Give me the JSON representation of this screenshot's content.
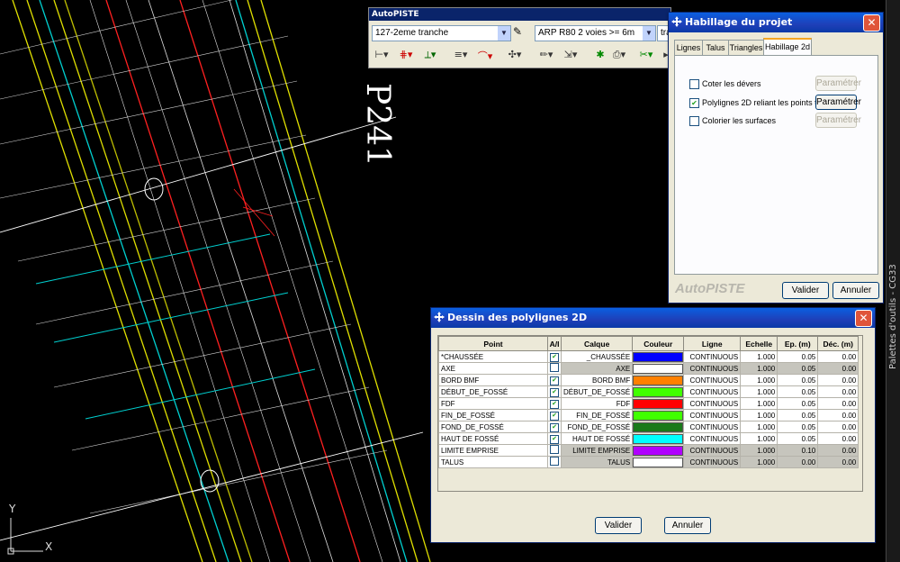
{
  "drawing": {
    "profile_label": "P241",
    "axis_y": "Y",
    "axis_x": "X"
  },
  "palette_side_label": "Palettes d'outils - CG33",
  "autopiste_toolbar": {
    "title": "AutoPISTE",
    "tranche_select": "127-2eme tranche",
    "profile_select": "ARP R80 2 voies >= 6m",
    "third_select": "tra",
    "tools": [
      "profile-tool-icon",
      "cross-section-tool-icon",
      "slope-tool-icon",
      "lines-tool-icon",
      "ditch-tool-icon",
      "axis-tool-icon",
      "draw-tool-icon",
      "export-tool-icon",
      "settings-tool-icon",
      "print-tool-icon",
      "layers-tool-icon",
      "help-tool-icon"
    ]
  },
  "habillage": {
    "title": "Habillage du projet",
    "tabs": [
      "Lignes",
      "Talus",
      "Triangles",
      "Habillage 2d"
    ],
    "active_tab": "Habillage 2d",
    "options": [
      {
        "label": "Coter les dévers",
        "checked": false,
        "button": "Paramétrer",
        "button_enabled": false
      },
      {
        "label": "Polylignes 2D reliant les points typés",
        "checked": true,
        "button": "Paramétrer",
        "button_enabled": true
      },
      {
        "label": "Colorier les surfaces",
        "checked": false,
        "button": "Paramétrer",
        "button_enabled": false
      }
    ],
    "brand": "AutoPISTE",
    "ok": "Valider",
    "cancel": "Annuler"
  },
  "dessin": {
    "title": "Dessin des polylignes 2D",
    "headers": [
      "Point",
      "A/I",
      "Calque",
      "Couleur",
      "Ligne",
      "Echelle",
      "Ep. (m)",
      "Déc. (m)"
    ],
    "rows": [
      {
        "point": "*CHAUSSÉE",
        "active": true,
        "calque": "_CHAUSSÉE",
        "color": "#0000ff",
        "ligne": "CONTINUOUS",
        "echelle": "1.000",
        "ep": "0.05",
        "dec": "0.00"
      },
      {
        "point": "AXE",
        "active": false,
        "calque": "AXE",
        "color": "#ffffff",
        "ligne": "CONTINUOUS",
        "echelle": "1.000",
        "ep": "0.05",
        "dec": "0.00"
      },
      {
        "point": "BORD BMF",
        "active": true,
        "calque": "BORD BMF",
        "color": "#ff8000",
        "ligne": "CONTINUOUS",
        "echelle": "1.000",
        "ep": "0.05",
        "dec": "0.00"
      },
      {
        "point": "DÉBUT_DE_FOSSÉ",
        "active": true,
        "calque": "DÉBUT_DE_FOSSÉ",
        "color": "#40ff00",
        "ligne": "CONTINUOUS",
        "echelle": "1.000",
        "ep": "0.05",
        "dec": "0.00"
      },
      {
        "point": "FDF",
        "active": true,
        "calque": "FDF",
        "color": "#ff0000",
        "ligne": "CONTINUOUS",
        "echelle": "1.000",
        "ep": "0.05",
        "dec": "0.00"
      },
      {
        "point": "FIN_DE_FOSSÉ",
        "active": true,
        "calque": "FIN_DE_FOSSÉ",
        "color": "#40ff00",
        "ligne": "CONTINUOUS",
        "echelle": "1.000",
        "ep": "0.05",
        "dec": "0.00"
      },
      {
        "point": "FOND_DE_FOSSÉ",
        "active": true,
        "calque": "FOND_DE_FOSSÉ",
        "color": "#1a7a1a",
        "ligne": "CONTINUOUS",
        "echelle": "1.000",
        "ep": "0.05",
        "dec": "0.00"
      },
      {
        "point": "HAUT DE FOSSÉ",
        "active": true,
        "calque": "HAUT DE FOSSÉ",
        "color": "#00ffff",
        "ligne": "CONTINUOUS",
        "echelle": "1.000",
        "ep": "0.05",
        "dec": "0.00"
      },
      {
        "point": "LIMITE EMPRISE",
        "active": false,
        "calque": "LIMITE EMPRISE",
        "color": "#b000ff",
        "ligne": "CONTINUOUS",
        "echelle": "1.000",
        "ep": "0.10",
        "dec": "0.00"
      },
      {
        "point": "TALUS",
        "active": false,
        "calque": "TALUS",
        "color": "#ffffff",
        "ligne": "CONTINUOUS",
        "echelle": "1.000",
        "ep": "0.00",
        "dec": "0.00"
      }
    ],
    "ok": "Valider",
    "cancel": "Annuler"
  }
}
